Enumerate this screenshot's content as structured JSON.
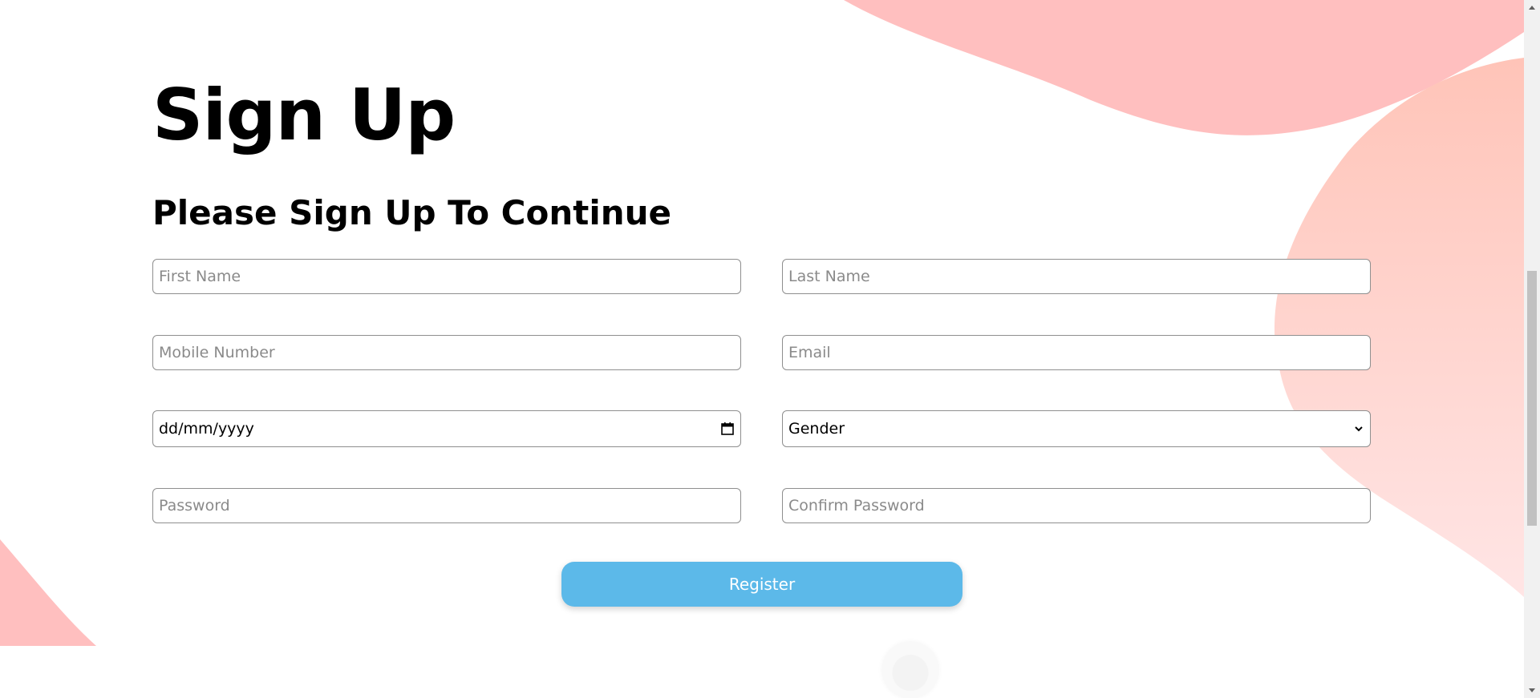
{
  "heading": {
    "title": "Sign Up",
    "subtitle": "Please Sign Up To Continue"
  },
  "form": {
    "first_name_placeholder": "First Name",
    "last_name_placeholder": "Last Name",
    "mobile_placeholder": "Mobile Number",
    "email_placeholder": "Email",
    "dob_placeholder": "dd/mm/yyyy",
    "gender_selected": "Gender",
    "password_placeholder": "Password",
    "confirm_password_placeholder": "Confirm Password",
    "register_label": "Register"
  },
  "icons": {
    "date": "calendar-icon",
    "select": "chevron-down-icon",
    "scroll_up": "triangle-up-icon",
    "scroll_down": "triangle-down-icon"
  },
  "colors": {
    "accent": "#5cb9e9",
    "blob": "#ffbfbf",
    "blob_light": "#ffe6e6"
  }
}
